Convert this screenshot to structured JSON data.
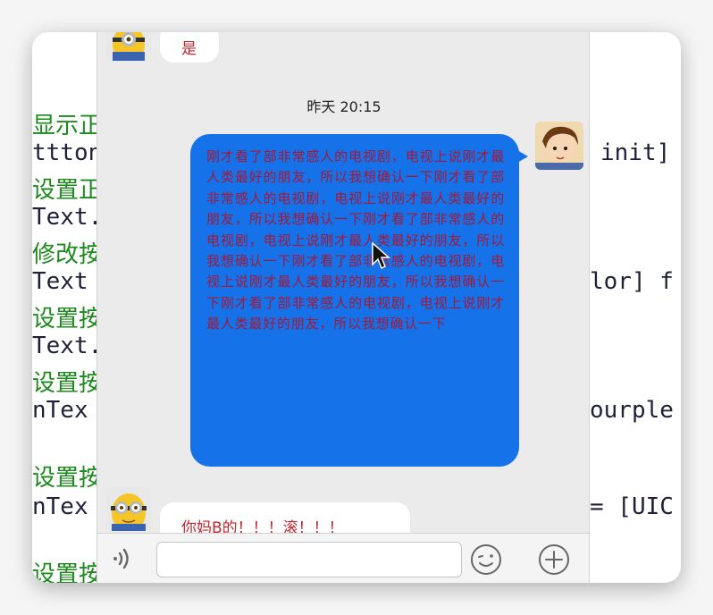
{
  "code_lines": [
    {
      "text": "显示正",
      "color": "green"
    },
    {
      "text": "ttton",
      "color": "dark"
    },
    {
      "text": "设置正",
      "color": "green"
    },
    {
      "text": "Text.",
      "color": "dark"
    },
    {
      "text": "修改按",
      "color": "green"
    },
    {
      "text": "Text",
      "color": "dark"
    },
    {
      "text": "设置按",
      "color": "green"
    },
    {
      "text": "Text.",
      "color": "dark"
    },
    {
      "text": "设置按",
      "color": "green"
    },
    {
      "text": "nTex",
      "color": "dark"
    },
    {
      "text": "设置按",
      "color": "green"
    },
    {
      "text": "nTex",
      "color": "dark"
    },
    {
      "text": "设置按",
      "color": "green"
    }
  ],
  "code_right": {
    "init": "init]",
    "color": "lor] f",
    "purple": "ourple",
    "uic": "= [UIC"
  },
  "chat": {
    "first_message": "是",
    "timestamp": "昨天 20:15",
    "sent_message": "刚才看了部非常感人的电视剧，电视上说刚才最人类最好的朋友，所以我想确认一下刚才看了部非常感人的电视剧，电视上说刚才最人类最好的朋友，所以我想确认一下刚才看了部非常感人的电视剧，电视上说刚才最人类最好的朋友，所以我想确认一下刚才看了部非常感人的电视剧，电视上说刚才最人类最好的朋友，所以我想确认一下刚才看了部非常感人的电视剧，电视上说刚才最人类最好的朋友，所以我想确认一下",
    "last_message": "你妈B的！！！滚！！！"
  },
  "colors": {
    "sent_bubble": "#1572e8",
    "sent_text": "#a2193b",
    "received_text": "#c4262e",
    "code_green": "#1c8a1c"
  },
  "icons": {
    "voice": "voice-wave-icon",
    "emoji": "emoji-face-icon",
    "plus": "plus-circle-icon"
  }
}
